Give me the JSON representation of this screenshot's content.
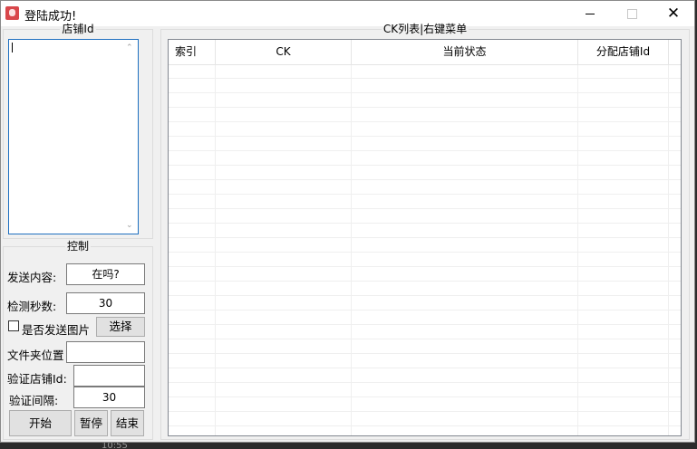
{
  "window": {
    "title": "登陆成功!"
  },
  "shop_panel": {
    "legend": "店铺Id",
    "textarea_value": ""
  },
  "control_panel": {
    "legend": "控制",
    "send_content_label": "发送内容:",
    "send_content_value": "在吗?",
    "check_seconds_label": "检测秒数:",
    "check_seconds_value": "30",
    "send_image_label": "是否发送图片",
    "send_image_checked": false,
    "select_label": "选择",
    "folder_label": "文件夹位置",
    "folder_value": "",
    "verify_shop_label": "验证店铺Id:",
    "verify_shop_value": "",
    "verify_interval_label": "验证间隔:",
    "verify_interval_value": "30",
    "start_label": "开始",
    "pause_label": "暂停",
    "stop_label": "结束"
  },
  "ck_panel": {
    "legend": "CK列表|右键菜单",
    "columns": [
      "索引",
      "CK",
      "当前状态",
      "分配店铺Id"
    ],
    "rows": []
  },
  "taskbar": {
    "time": "10:55"
  }
}
